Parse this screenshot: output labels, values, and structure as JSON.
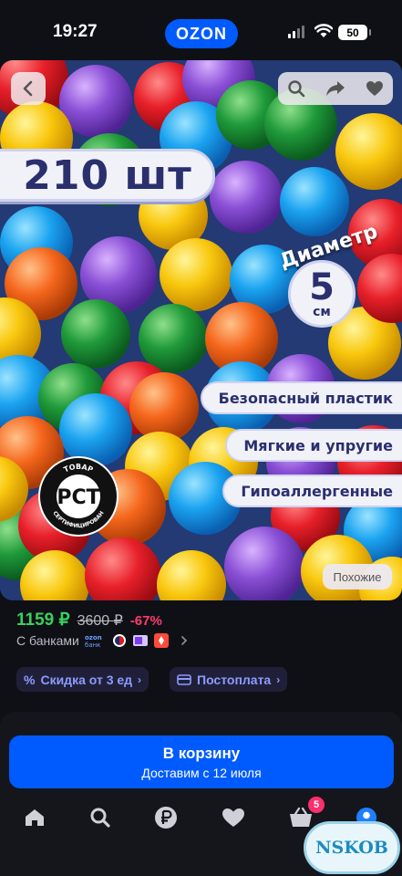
{
  "status_bar": {
    "time": "19:27",
    "brand": "OZON",
    "battery": "50"
  },
  "product_image": {
    "count_text": "210 шт",
    "diameter_label": "Диаметр",
    "diameter_value": "5",
    "diameter_unit": "см",
    "features": [
      "Безопасный пластик",
      "Мягкие и упругие",
      "Гипоаллергенные"
    ],
    "cert_text": "ТОВАР СЕРТИФИЦИРОВАН",
    "similar_button": "Похожие"
  },
  "price": {
    "current": "1159 ₽",
    "old": "3600 ₽",
    "discount": "-67%",
    "banks_label": "С банками"
  },
  "chips": [
    {
      "label": "Скидка от 3 ед",
      "icon": "percent-icon"
    },
    {
      "label": "Постоплата",
      "icon": "card-icon"
    }
  ],
  "cart_button": {
    "label": "В корзину",
    "delivery": "Доставим с 12 июля"
  },
  "tabbar": {
    "cart_count": "5"
  },
  "watermark": "NSKOB",
  "colors": {
    "brand_blue": "#005bff",
    "price_green": "#3ccf5c",
    "discount_pink": "#ff3b6b",
    "chip_text": "#8e9bff"
  }
}
